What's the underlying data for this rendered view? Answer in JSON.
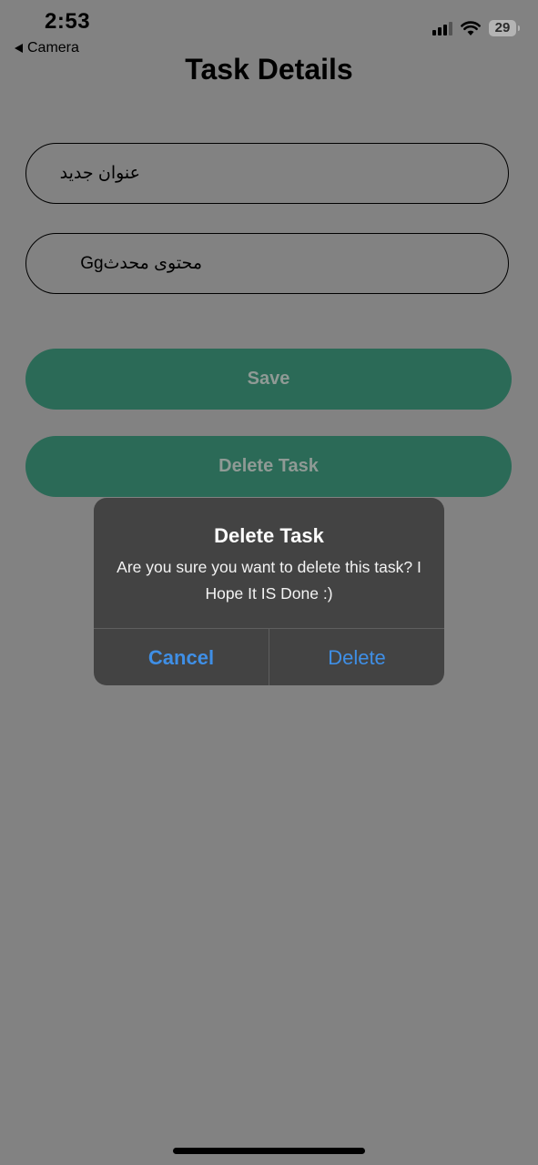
{
  "status_bar": {
    "time": "2:53",
    "back_label": "Camera",
    "battery_level": "29"
  },
  "header": {
    "title": "Task Details"
  },
  "form": {
    "title_value": "عنوان جدید",
    "content_value": "محتوی محدثGg",
    "save_label": "Save",
    "delete_label": "Delete Task"
  },
  "alert": {
    "title": "Delete Task",
    "message": "Are you sure you want to delete this task? I Hope It IS Done :)",
    "cancel_label": "Cancel",
    "delete_label": "Delete"
  },
  "colors": {
    "background": "#828282",
    "button": "#2b6a57",
    "alert_bg": "#434343",
    "alert_action": "#3f8fe6"
  },
  "icons": {
    "signal": "cellular-signal-icon",
    "wifi": "wifi-icon",
    "battery": "battery-icon",
    "back": "back-arrow-icon"
  }
}
